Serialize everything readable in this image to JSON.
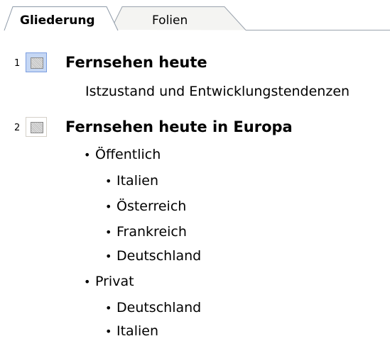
{
  "tabs": [
    {
      "label": "Gliederung",
      "active": true
    },
    {
      "label": "Folien",
      "active": false
    }
  ],
  "slides": [
    {
      "number": "1",
      "title": "Fernsehen heute",
      "subtitle": "Istzustand und Entwicklungstendenzen",
      "selected": true
    },
    {
      "number": "2",
      "title": "Fernsehen heute in Europa",
      "selected": false,
      "bullets": [
        {
          "text": "Öffentlich",
          "children": [
            "Italien",
            "Österreich",
            "Frankreich",
            "Deutschland"
          ]
        },
        {
          "text": "Privat",
          "children": [
            "Deutschland",
            "Italien"
          ]
        }
      ]
    }
  ],
  "colors": {
    "selected_icon_fill": "#c5d7f4",
    "selected_icon_border": "#7b9ee0",
    "tab_border": "#8e9aa8"
  }
}
